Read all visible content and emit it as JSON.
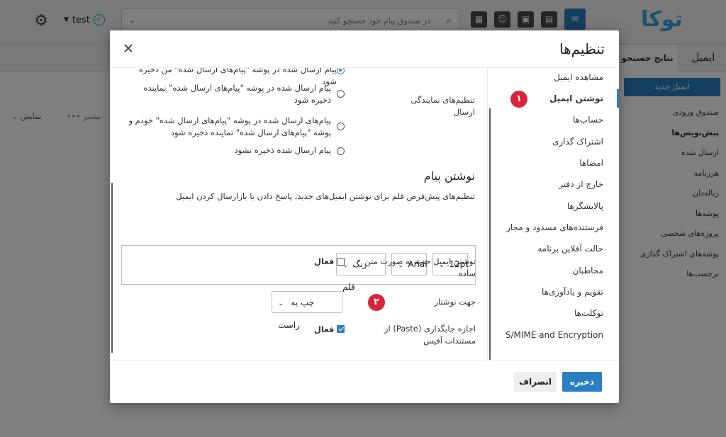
{
  "app": {
    "logo": "توکا",
    "user": "test",
    "search_placeholder": "در صندوق پیام خود جستجو کنید",
    "tabs": [
      "ایمیل",
      "نتایج جستجو"
    ],
    "new_mail": "ایمیل جدید",
    "folders": [
      "صندوق ورودی",
      "پیش‌نویس‌ها",
      "ارسال شده",
      "هرزنامه",
      "زباله‌دان",
      "پوشه‌ها",
      "پروژه‌های شخصی",
      "پوشه‌های اشتراک گذاری",
      "برچسب‌ها"
    ],
    "view_label": "نمایش",
    "sort_label": "بیشتر"
  },
  "modal": {
    "title": "تنظیم‌ها",
    "nav": [
      "مشاهده ایمیل",
      "نوشتن ایمیل",
      "حساب‌ها",
      "اشتراک گذاری",
      "امضاها",
      "خارج از دفتر",
      "پالایشگرها",
      "فرستنده‌های مسدود و مجاز",
      "حالت آفلاین برنامه",
      "مخاطبان",
      "تقویم و یادآوری‌ها",
      "توکلت‌ها",
      "S/MIME and Encryption"
    ],
    "badge1": "۱",
    "badge2": "۲",
    "delegate_label": "تنظیم‌های نمایندگی ارسال",
    "radio_options": [
      "پیام ارسال شده در پوشه \"پیام‌های ارسال شده\" من ذخیره شود",
      "پیام ارسال شده در پوشه \"پیام‌های ارسال شده\" نماینده ذخیره شود",
      "پیام‌های ارسال شده در پوشه \"پیام‌های ارسال شده\" خودم و پوشه \"پیام‌های ارسال شده\" نماینده ذخیره شود",
      "پیام ارسال شده ذخیره نشود"
    ],
    "compose_title": "نوشتن پیام",
    "compose_desc": "تنظیم‌های پیش‌فرض قلم برای نوشتن ایمیل‌های جدید، پاسخ دادن یا بازارسال کردن ایمیل",
    "font_size": "12pt",
    "font_family": "Arial",
    "font_color": "رنگ قلم",
    "plain_text_label": "نوشتن ایمیل جدید به صورت متن ساده",
    "plain_text_value": "فعال",
    "direction_label": "جهت نوشتار",
    "direction_value": "چپ به راست",
    "paste_label": "اجازه جایگذاری (Paste) از مستندات آفیس",
    "paste_value": "فعال",
    "save": "ذخیره",
    "cancel": "انصراف"
  }
}
